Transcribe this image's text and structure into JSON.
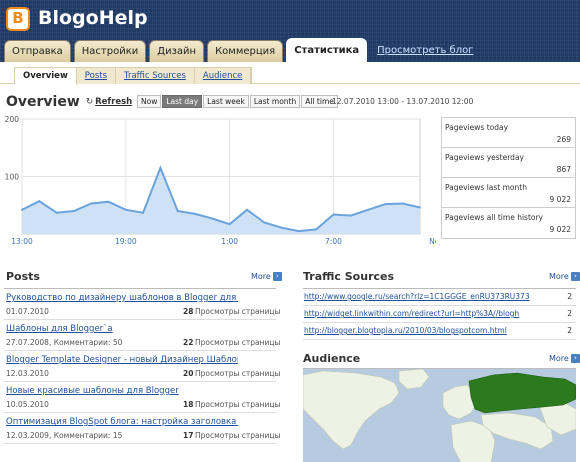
{
  "app": {
    "logo_letter": "B",
    "name": "BlogoHelp",
    "brand_color": "#203a66"
  },
  "main_tabs": [
    {
      "label": "Отправка",
      "active": false
    },
    {
      "label": "Настройки",
      "active": false
    },
    {
      "label": "Дизайн",
      "active": false
    },
    {
      "label": "Коммерция",
      "active": false
    },
    {
      "label": "Статистика",
      "active": true
    }
  ],
  "view_blog_link": "Просмотреть блог",
  "sub_tabs": [
    {
      "label": "Overview",
      "active": true
    },
    {
      "label": "Posts",
      "active": false
    },
    {
      "label": "Traffic Sources",
      "active": false
    },
    {
      "label": "Audience",
      "active": false
    }
  ],
  "overview": {
    "title": "Overview",
    "refresh_label": "Refresh",
    "ranges": [
      {
        "label": "Now",
        "active": false
      },
      {
        "label": "Last day",
        "active": true
      },
      {
        "label": "Last week",
        "active": false
      },
      {
        "label": "Last month",
        "active": false
      },
      {
        "label": "All time",
        "active": false
      }
    ],
    "date_range": "12.07.2010 13:00 - 13.07.2010 12:00"
  },
  "chart_data": {
    "type": "area",
    "y_ticks": [
      100,
      200
    ],
    "ylim": [
      0,
      200
    ],
    "x_tick_labels": [
      "13:00",
      "19:00",
      "1:00",
      "7:00",
      "Now"
    ],
    "x_tick_positions": [
      0,
      6,
      12,
      18,
      24
    ],
    "values": [
      42,
      57,
      37,
      40,
      53,
      56,
      42,
      37,
      115,
      40,
      35,
      27,
      17,
      42,
      20,
      11,
      5,
      8,
      34,
      32,
      42,
      52,
      53,
      46
    ],
    "series_color": "#6aa3dc",
    "grid": true
  },
  "stats": [
    {
      "label": "Pageviews today",
      "value": "269"
    },
    {
      "label": "Pageviews yesterday",
      "value": "867"
    },
    {
      "label": "Pageviews last month",
      "value": "9 022"
    },
    {
      "label": "Pageviews all time history",
      "value": "9 022"
    }
  ],
  "posts": {
    "title": "Posts",
    "more_label": "More",
    "items": [
      {
        "title": "Руководство по дизайнеру шаблонов в Blogger для но...",
        "date": "01.07.2010",
        "comments": "",
        "views": "28",
        "views_label": "Просмотры страницы"
      },
      {
        "title": "Шаблоны для Blogger`а",
        "date": "27.07.2008, Комментарии: 50",
        "comments": "",
        "views": "22",
        "views_label": "Просмотры страницы"
      },
      {
        "title": "Blogger Template Designer - новый Дизайнер Шаблоно...",
        "date": "12.03.2010",
        "comments": "",
        "views": "20",
        "views_label": "Просмотры страницы"
      },
      {
        "title": "Новые красивые шаблоны для Blogger",
        "date": "10.05.2010",
        "comments": "",
        "views": "18",
        "views_label": "Просмотры страницы"
      },
      {
        "title": "Оптимизация BlogSpot блога: настройка заголовка TI...",
        "date": "12.03.2009, Комментарии: 15",
        "comments": "",
        "views": "17",
        "views_label": "Просмотры страницы"
      }
    ]
  },
  "traffic": {
    "title": "Traffic Sources",
    "more_label": "More",
    "items": [
      {
        "url": "http://www.google.ru/search?rlz=1C1GGGE_enRU373RU373",
        "count": "2"
      },
      {
        "url": "http://widget.linkwithin.com/redirect?url=http%3A//blogh",
        "count": "2"
      },
      {
        "url": "http://blogger.blogtopla.ru/2010/03/blogspotcom.html",
        "count": "2"
      }
    ]
  },
  "audience": {
    "title": "Audience",
    "more_label": "More",
    "map_colors": {
      "ocean": "#b7cbe0",
      "land": "#eef2e4",
      "highlight": "#2d7a1e"
    }
  }
}
